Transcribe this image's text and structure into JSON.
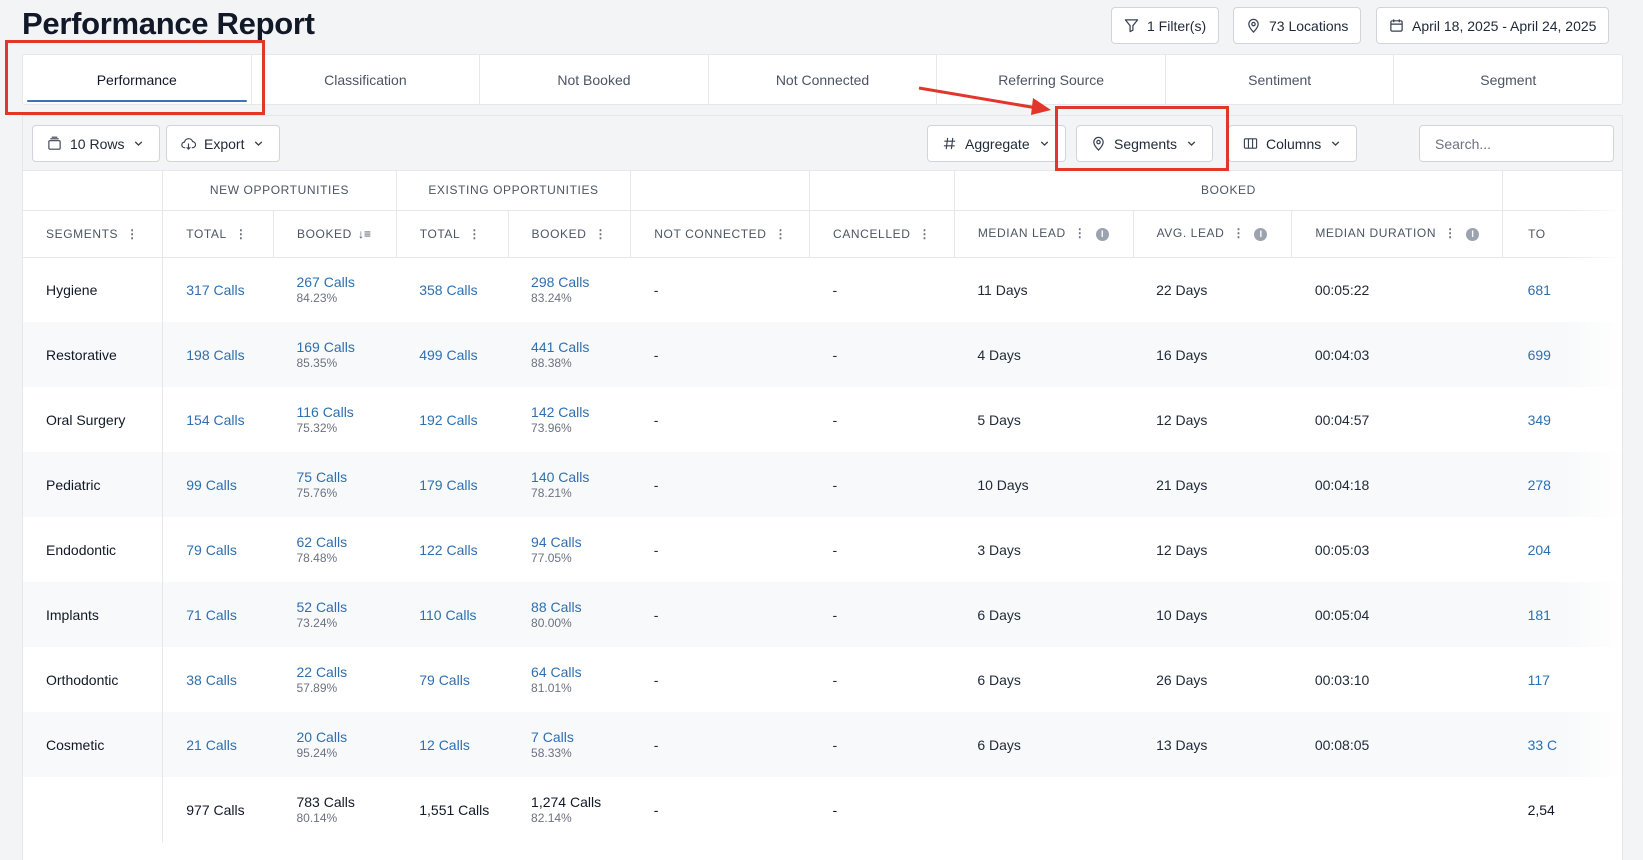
{
  "header": {
    "title": "Performance Report",
    "filters_label": "1 Filter(s)",
    "locations_label": "73 Locations",
    "date_range_label": "April 18, 2025 - April 24, 2025"
  },
  "tabs": [
    {
      "label": "Performance",
      "active": true
    },
    {
      "label": "Classification"
    },
    {
      "label": "Not Booked"
    },
    {
      "label": "Not Connected"
    },
    {
      "label": "Referring Source"
    },
    {
      "label": "Sentiment"
    },
    {
      "label": "Segment"
    }
  ],
  "toolbar": {
    "rows_label": "10 Rows",
    "export_label": "Export",
    "aggregate_label": "Aggregate",
    "segments_label": "Segments",
    "columns_label": "Columns",
    "search_placeholder": "Search..."
  },
  "table": {
    "groups": {
      "new_opportunities": "NEW OPPORTUNITIES",
      "existing_opportunities": "EXISTING OPPORTUNITIES",
      "booked": "BOOKED"
    },
    "columns": {
      "segments": "SEGMENTS",
      "new_total": "TOTAL",
      "new_booked": "BOOKED",
      "existing_total": "TOTAL",
      "existing_booked": "BOOKED",
      "not_connected": "NOT CONNECTED",
      "cancelled": "CANCELLED",
      "median_lead": "MEDIAN LEAD",
      "avg_lead": "AVG. LEAD",
      "median_duration": "MEDIAN DURATION",
      "total_partial": "TO"
    },
    "rows": [
      {
        "segment": "Hygiene",
        "new_total": "317 Calls",
        "new_booked": "267 Calls",
        "new_booked_pct": "84.23%",
        "ex_total": "358 Calls",
        "ex_booked": "298 Calls",
        "ex_booked_pct": "83.24%",
        "not_connected": "-",
        "cancelled": "-",
        "median_lead": "11 Days",
        "avg_lead": "22 Days",
        "median_duration": "00:05:22",
        "total": "681"
      },
      {
        "segment": "Restorative",
        "new_total": "198 Calls",
        "new_booked": "169 Calls",
        "new_booked_pct": "85.35%",
        "ex_total": "499 Calls",
        "ex_booked": "441 Calls",
        "ex_booked_pct": "88.38%",
        "not_connected": "-",
        "cancelled": "-",
        "median_lead": "4 Days",
        "avg_lead": "16 Days",
        "median_duration": "00:04:03",
        "total": "699"
      },
      {
        "segment": "Oral Surgery",
        "new_total": "154 Calls",
        "new_booked": "116 Calls",
        "new_booked_pct": "75.32%",
        "ex_total": "192 Calls",
        "ex_booked": "142 Calls",
        "ex_booked_pct": "73.96%",
        "not_connected": "-",
        "cancelled": "-",
        "median_lead": "5 Days",
        "avg_lead": "12 Days",
        "median_duration": "00:04:57",
        "total": "349"
      },
      {
        "segment": "Pediatric",
        "new_total": "99 Calls",
        "new_booked": "75 Calls",
        "new_booked_pct": "75.76%",
        "ex_total": "179 Calls",
        "ex_booked": "140 Calls",
        "ex_booked_pct": "78.21%",
        "not_connected": "-",
        "cancelled": "-",
        "median_lead": "10 Days",
        "avg_lead": "21 Days",
        "median_duration": "00:04:18",
        "total": "278"
      },
      {
        "segment": "Endodontic",
        "new_total": "79 Calls",
        "new_booked": "62 Calls",
        "new_booked_pct": "78.48%",
        "ex_total": "122 Calls",
        "ex_booked": "94 Calls",
        "ex_booked_pct": "77.05%",
        "not_connected": "-",
        "cancelled": "-",
        "median_lead": "3 Days",
        "avg_lead": "12 Days",
        "median_duration": "00:05:03",
        "total": "204"
      },
      {
        "segment": "Implants",
        "new_total": "71 Calls",
        "new_booked": "52 Calls",
        "new_booked_pct": "73.24%",
        "ex_total": "110 Calls",
        "ex_booked": "88 Calls",
        "ex_booked_pct": "80.00%",
        "not_connected": "-",
        "cancelled": "-",
        "median_lead": "6 Days",
        "avg_lead": "10 Days",
        "median_duration": "00:05:04",
        "total": "181"
      },
      {
        "segment": "Orthodontic",
        "new_total": "38 Calls",
        "new_booked": "22 Calls",
        "new_booked_pct": "57.89%",
        "ex_total": "79 Calls",
        "ex_booked": "64 Calls",
        "ex_booked_pct": "81.01%",
        "not_connected": "-",
        "cancelled": "-",
        "median_lead": "6 Days",
        "avg_lead": "26 Days",
        "median_duration": "00:03:10",
        "total": "117"
      },
      {
        "segment": "Cosmetic",
        "new_total": "21 Calls",
        "new_booked": "20 Calls",
        "new_booked_pct": "95.24%",
        "ex_total": "12 Calls",
        "ex_booked": "7 Calls",
        "ex_booked_pct": "58.33%",
        "not_connected": "-",
        "cancelled": "-",
        "median_lead": "6 Days",
        "avg_lead": "13 Days",
        "median_duration": "00:08:05",
        "total": "33 C"
      }
    ],
    "totals": {
      "segment": "",
      "new_total": "977 Calls",
      "new_booked": "783 Calls",
      "new_booked_pct": "80.14%",
      "ex_total": "1,551 Calls",
      "ex_booked": "1,274 Calls",
      "ex_booked_pct": "82.14%",
      "not_connected": "-",
      "cancelled": "-",
      "median_lead": "",
      "avg_lead": "",
      "median_duration": "",
      "total": "2,54"
    }
  }
}
